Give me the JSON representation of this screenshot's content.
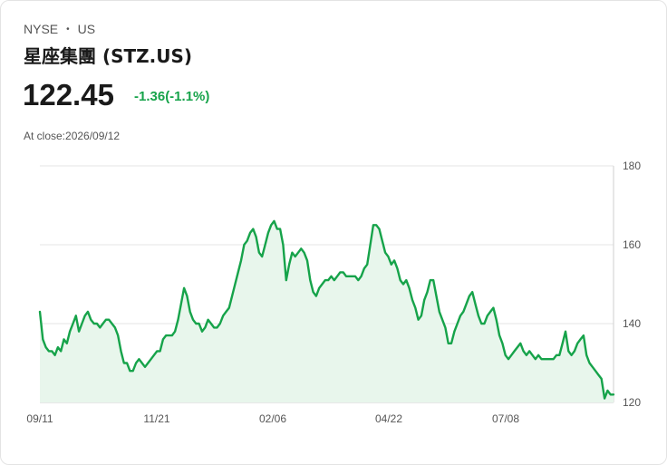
{
  "header": {
    "exchange": "NYSE",
    "separator": "•",
    "country": "US",
    "name": "星座集團 (STZ.US)",
    "price": "122.45",
    "change": "-1.36(-1.1%)",
    "close_label": "At close:2026/09/12"
  },
  "colors": {
    "line": "#16a34a",
    "fill": "#e8f6ec",
    "grid": "#e6e6e6"
  },
  "chart_data": {
    "type": "area",
    "title": "",
    "xlabel": "",
    "ylabel": "",
    "ylim": [
      120,
      180
    ],
    "yticks": [
      120,
      140,
      160,
      180
    ],
    "xticks": [
      "09/11",
      "11/21",
      "02/06",
      "04/22",
      "07/08"
    ],
    "y_axis_position": "right",
    "grid": true,
    "series": [
      {
        "values": [
          143,
          136,
          134,
          133,
          133,
          132,
          134,
          133,
          136,
          135,
          138,
          140,
          142,
          138,
          140,
          142,
          143,
          141,
          140,
          140,
          139,
          140,
          141,
          141,
          140,
          139,
          137,
          133,
          130,
          130,
          128,
          128,
          130,
          131,
          130,
          129,
          130,
          131,
          132,
          133,
          133,
          136,
          137,
          137,
          137,
          138,
          141,
          145,
          149,
          147,
          143,
          141,
          140,
          140,
          138,
          139,
          141,
          140,
          139,
          139,
          140,
          142,
          143,
          144,
          147,
          150,
          153,
          156,
          160,
          161,
          163,
          164,
          162,
          158,
          157,
          160,
          163,
          165,
          166,
          164,
          164,
          160,
          151,
          155,
          158,
          157,
          158,
          159,
          158,
          156,
          151,
          148,
          147,
          149,
          150,
          151,
          151,
          152,
          151,
          152,
          153,
          153,
          152,
          152,
          152,
          152,
          151,
          152,
          154,
          155,
          160,
          165,
          165,
          164,
          161,
          158,
          157,
          155,
          156,
          154,
          151,
          150,
          151,
          149,
          146,
          144,
          141,
          142,
          146,
          148,
          151,
          151,
          147,
          143,
          141,
          139,
          135,
          135,
          138,
          140,
          142,
          143,
          145,
          147,
          148,
          145,
          142,
          140,
          140,
          142,
          143,
          144,
          141,
          137,
          135,
          132,
          131,
          132,
          133,
          134,
          135,
          133,
          132,
          133,
          132,
          131,
          132,
          131,
          131,
          131,
          131,
          131,
          132,
          132,
          135,
          138,
          133,
          132,
          133,
          135,
          136,
          137,
          132,
          130,
          129,
          128,
          127,
          126,
          121,
          123,
          122,
          122
        ]
      }
    ]
  }
}
